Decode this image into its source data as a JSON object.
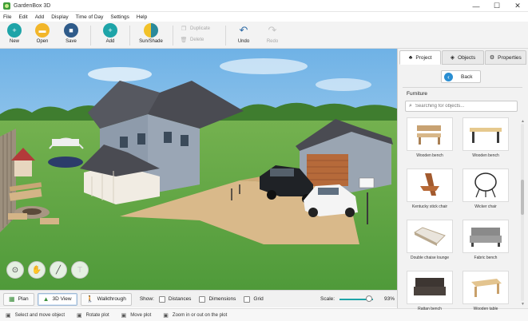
{
  "window": {
    "title": "GardenBox 3D"
  },
  "menu": [
    "File",
    "Edit",
    "Add",
    "Display",
    "Time of Day",
    "Settings",
    "Help"
  ],
  "toolbar": {
    "new": "New",
    "open": "Open",
    "save": "Save",
    "add": "Add",
    "sun_shade": "Sun/Shade",
    "duplicate": "Duplicate",
    "delete": "Delete",
    "undo": "Undo",
    "redo": "Redo"
  },
  "viewbar": {
    "plan": "Plan",
    "view3d": "3D View",
    "walkthrough": "Walkthrough",
    "show_label": "Show:",
    "distances": "Distances",
    "dimensions": "Dimensions",
    "grid": "Grid",
    "scale_label": "Scale:",
    "scale_value": "93%"
  },
  "status": {
    "select": "Select and move object",
    "rotate": "Rotate plot",
    "move": "Move plot",
    "zoom": "Zoom in or out on the plot"
  },
  "panel": {
    "tabs": [
      "Project",
      "Objects",
      "Properties"
    ],
    "active_tab": "Project",
    "back": "Back",
    "category": "Furniture",
    "search_placeholder": "Searching for objects...",
    "items": [
      "Wooden bench",
      "Wooden bench",
      "Kentucky stick chair",
      "Wicker chair",
      "Double chaise lounge",
      "Fabric bench",
      "Rattan bench",
      "Wooden table"
    ]
  },
  "icons": {
    "new": "plus-circle-icon",
    "open": "folder-icon",
    "save": "floppy-disk-icon",
    "add": "plus-icon",
    "sun_shade": "sun-shade-icon",
    "undo": "undo-arrow-icon",
    "redo": "redo-arrow-icon"
  },
  "colors": {
    "accent": "#1ea4a8",
    "back_button": "#2a8ed2",
    "grass": "#5aa845"
  }
}
